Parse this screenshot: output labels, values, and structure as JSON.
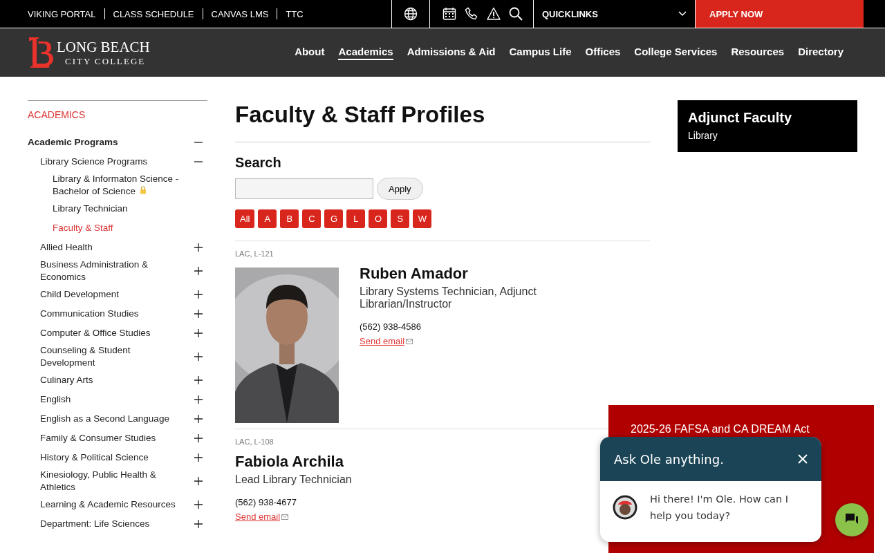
{
  "top_bar": {
    "links": [
      "VIKING PORTAL",
      "CLASS SCHEDULE",
      "CANVAS LMS",
      "TTC"
    ],
    "quicklinks": "QUICKLINKS",
    "apply": "APPLY NOW"
  },
  "header": {
    "logo_top": "LONG BEACH",
    "logo_bottom": "CITY COLLEGE",
    "nav": [
      {
        "label": "About",
        "selected": false
      },
      {
        "label": "Academics",
        "selected": true
      },
      {
        "label": "Admissions & Aid",
        "selected": false
      },
      {
        "label": "Campus Life",
        "selected": false
      },
      {
        "label": "Offices",
        "selected": false
      },
      {
        "label": "College Services",
        "selected": false
      },
      {
        "label": "Resources",
        "selected": false
      },
      {
        "label": "Directory",
        "selected": false
      }
    ]
  },
  "sidebar": {
    "heading": "ACADEMICS",
    "items": [
      {
        "label": "Academic Programs",
        "expanded": true,
        "selected": false,
        "children": [
          {
            "label": "Library Science Programs",
            "expanded": true,
            "selected": false,
            "children": [
              {
                "label": "Library & Informaton Science - Bachelor of Science",
                "locked": true,
                "selected": false
              },
              {
                "label": "Library Technician",
                "locked": false,
                "selected": false
              },
              {
                "label": "Faculty & Staff",
                "locked": false,
                "selected": true
              }
            ]
          },
          {
            "label": "Allied Health",
            "expanded": false,
            "selected": false
          },
          {
            "label": "Business Administration & Economics",
            "expanded": false,
            "selected": false
          },
          {
            "label": "Child Development",
            "expanded": false,
            "selected": false
          },
          {
            "label": "Communication Studies",
            "expanded": false,
            "selected": false
          },
          {
            "label": "Computer & Office Studies",
            "expanded": false,
            "selected": false
          },
          {
            "label": "Counseling & Student Development",
            "expanded": false,
            "selected": false
          },
          {
            "label": "Culinary Arts",
            "expanded": false,
            "selected": false
          },
          {
            "label": "English",
            "expanded": false,
            "selected": false
          },
          {
            "label": "English as a Second Language",
            "expanded": false,
            "selected": false
          },
          {
            "label": "Family & Consumer Studies",
            "expanded": false,
            "selected": false
          },
          {
            "label": "History & Political Science",
            "expanded": false,
            "selected": false
          },
          {
            "label": "Kinesiology, Public Health & Athletics",
            "expanded": false,
            "selected": false
          },
          {
            "label": "Learning & Academic Resources",
            "expanded": false,
            "selected": false
          },
          {
            "label": "Department: Life Sciences",
            "expanded": false,
            "selected": false
          }
        ]
      }
    ]
  },
  "main": {
    "title": "Faculty & Staff Profiles",
    "search_label": "Search",
    "apply_button": "Apply",
    "letters": [
      "All",
      "A",
      "B",
      "C",
      "G",
      "L",
      "O",
      "S",
      "W"
    ],
    "profiles": [
      {
        "location": "LAC, L-121",
        "name": "Ruben Amador",
        "title": "Library Systems Technician, Adjunct Librarian/Instructor",
        "phone": "(562) 938-4586",
        "email": "Send email"
      },
      {
        "location": "LAC, L-108",
        "name": "Fabiola Archila",
        "title": "Lead Library Technician",
        "phone": "(562) 938-4677",
        "email": "Send email"
      }
    ]
  },
  "aside": {
    "title": "Adjunct Faculty",
    "subtitle": "Library"
  },
  "banner": {
    "text": "2025-26 FAFSA and CA DREAM Act"
  },
  "chat": {
    "title": "Ask Ole anything.",
    "message": "Hi there! I'm Ole. How can I help you today?"
  }
}
